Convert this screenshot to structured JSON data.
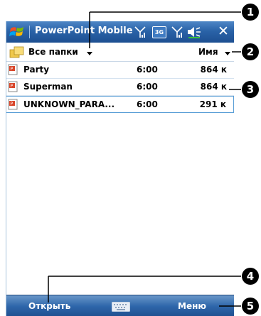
{
  "app": {
    "title": "PowerPoint Mobile",
    "close_label": "✕"
  },
  "status_icons": [
    "antenna-signal-icon",
    "3g-icon",
    "signal-strength-icon",
    "speaker-icon"
  ],
  "status_3g": "3G",
  "folder_bar": {
    "folder_label": "Все папки",
    "sort_label": "Имя"
  },
  "files": [
    {
      "name": "Party",
      "time": "6:00",
      "size": "864 к"
    },
    {
      "name": "Superman",
      "time": "6:00",
      "size": "864 к"
    },
    {
      "name": "UNKNOWN_PARA...",
      "time": "6:00",
      "size": "291 к"
    }
  ],
  "softkeys": {
    "left": "Открыть",
    "right": "Меню"
  },
  "callouts": [
    "1",
    "2",
    "3",
    "4",
    "5"
  ],
  "colors": {
    "titlebar": "#2a63a8",
    "selection_border": "#5a9fd6",
    "callout": "#000000"
  }
}
